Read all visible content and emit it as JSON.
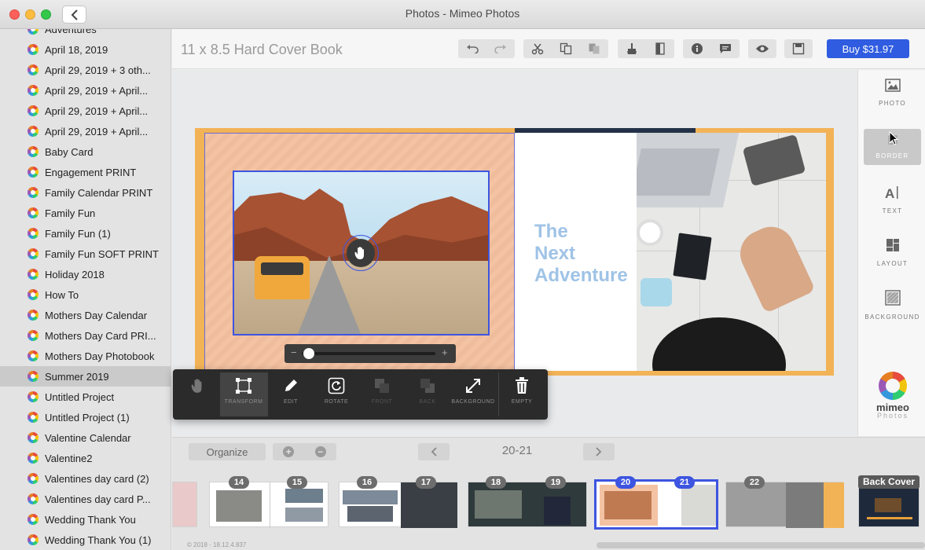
{
  "window": {
    "title": "Photos - Mimeo Photos"
  },
  "sidebar": {
    "items": [
      {
        "label": "Adventures",
        "selected": false
      },
      {
        "label": "April 18, 2019",
        "selected": false
      },
      {
        "label": "April 29, 2019 + 3 oth...",
        "selected": false
      },
      {
        "label": "April 29, 2019 + April...",
        "selected": false
      },
      {
        "label": "April 29, 2019 + April...",
        "selected": false
      },
      {
        "label": "April 29, 2019 + April...",
        "selected": false
      },
      {
        "label": "Baby Card",
        "selected": false
      },
      {
        "label": "Engagement PRINT",
        "selected": false
      },
      {
        "label": "Family Calendar PRINT",
        "selected": false
      },
      {
        "label": "Family Fun",
        "selected": false
      },
      {
        "label": "Family Fun (1)",
        "selected": false
      },
      {
        "label": "Family Fun SOFT PRINT",
        "selected": false
      },
      {
        "label": "Holiday 2018",
        "selected": false
      },
      {
        "label": "How To",
        "selected": false
      },
      {
        "label": "Mothers Day Calendar",
        "selected": false
      },
      {
        "label": "Mothers Day Card PRI...",
        "selected": false
      },
      {
        "label": "Mothers Day Photobook",
        "selected": false
      },
      {
        "label": "Summer 2019",
        "selected": true
      },
      {
        "label": "Untitled Project",
        "selected": false
      },
      {
        "label": "Untitled Project (1)",
        "selected": false
      },
      {
        "label": "Valentine Calendar",
        "selected": false
      },
      {
        "label": "Valentine2",
        "selected": false
      },
      {
        "label": "Valentines day card (2)",
        "selected": false
      },
      {
        "label": "Valentines day card P...",
        "selected": false
      },
      {
        "label": "Wedding Thank You",
        "selected": false
      },
      {
        "label": "Wedding Thank You (1)",
        "selected": false
      }
    ]
  },
  "toolbar": {
    "book_title": "11 x 8.5 Hard Cover Book",
    "buy_label": "Buy $31.97",
    "icons": [
      "undo-icon",
      "redo-icon",
      "cut-icon",
      "copy-icon",
      "paste-icon",
      "clean-icon",
      "book-icon",
      "info-icon",
      "comment-icon",
      "preview-icon",
      "save-icon"
    ]
  },
  "spread": {
    "headline": [
      "The",
      "Next",
      "Adventure"
    ],
    "zoom_level": 0.05
  },
  "edit_tools": {
    "items": [
      {
        "label": "",
        "icon": "hand-icon",
        "dim": false,
        "active": false
      },
      {
        "label": "TRANSFORM",
        "icon": "transform-icon",
        "dim": false,
        "active": true
      },
      {
        "label": "EDIT",
        "icon": "pencil-icon",
        "dim": false,
        "active": false
      },
      {
        "label": "ROTATE",
        "icon": "rotate-icon",
        "dim": false,
        "active": false
      },
      {
        "label": "FRONT",
        "icon": "front-icon",
        "dim": true,
        "active": false
      },
      {
        "label": "BACK",
        "icon": "back-icon",
        "dim": true,
        "active": false
      },
      {
        "label": "BACKGROUND",
        "icon": "expand-icon",
        "dim": false,
        "active": false
      },
      {
        "label": "EMPTY",
        "icon": "trash-icon",
        "dim": false,
        "active": false
      }
    ]
  },
  "right_panel": {
    "items": [
      {
        "label": "PHOTO",
        "icon": "photo-icon",
        "active": false
      },
      {
        "label": "BORDER",
        "icon": "border-icon",
        "active": true
      },
      {
        "label": "TEXT",
        "icon": "text-icon",
        "active": false
      },
      {
        "label": "LAYOUT",
        "icon": "layout-icon",
        "active": false
      },
      {
        "label": "BACKGROUND",
        "icon": "background-icon",
        "active": false
      }
    ],
    "logo_word": "mimeo",
    "logo_sub": "Photos"
  },
  "bottom": {
    "organize_label": "Organize",
    "page_range": "20-21",
    "pages": [
      "14",
      "15",
      "16",
      "17",
      "18",
      "19",
      "20",
      "21",
      "22"
    ],
    "selected_pages": [
      "20",
      "21"
    ],
    "cover_label": "Back Cover",
    "copyright": "© 2018 - 18.12.4.837"
  },
  "colors": {
    "accent": "#2f5ce0",
    "selection": "#3d55e0",
    "spread_border": "#f2b357",
    "headline": "#9fc3e6"
  }
}
